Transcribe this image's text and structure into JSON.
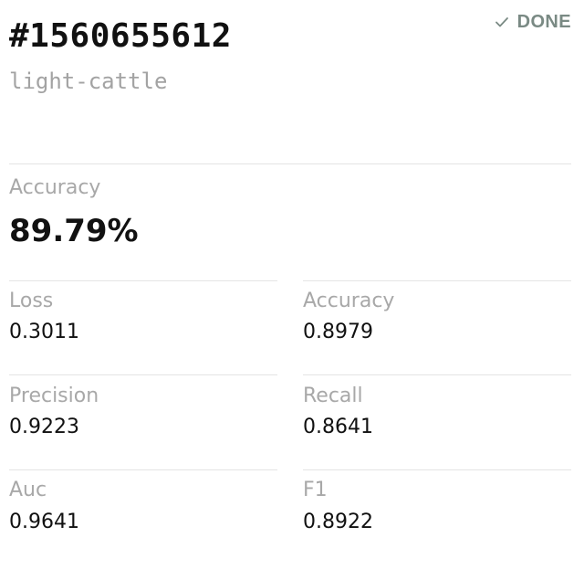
{
  "run": {
    "id": "#1560655612",
    "name": "light-cattle",
    "status": "DONE",
    "status_icon": "check-icon",
    "status_color": "#7a8a84"
  },
  "headline_metric": {
    "label": "Accuracy",
    "value": "89.79%"
  },
  "metrics": [
    {
      "label": "Loss",
      "value": "0.3011"
    },
    {
      "label": "Accuracy",
      "value": "0.8979"
    },
    {
      "label": "Precision",
      "value": "0.9223"
    },
    {
      "label": "Recall",
      "value": "0.8641"
    },
    {
      "label": "Auc",
      "value": "0.9641"
    },
    {
      "label": "F1",
      "value": "0.8922"
    }
  ]
}
